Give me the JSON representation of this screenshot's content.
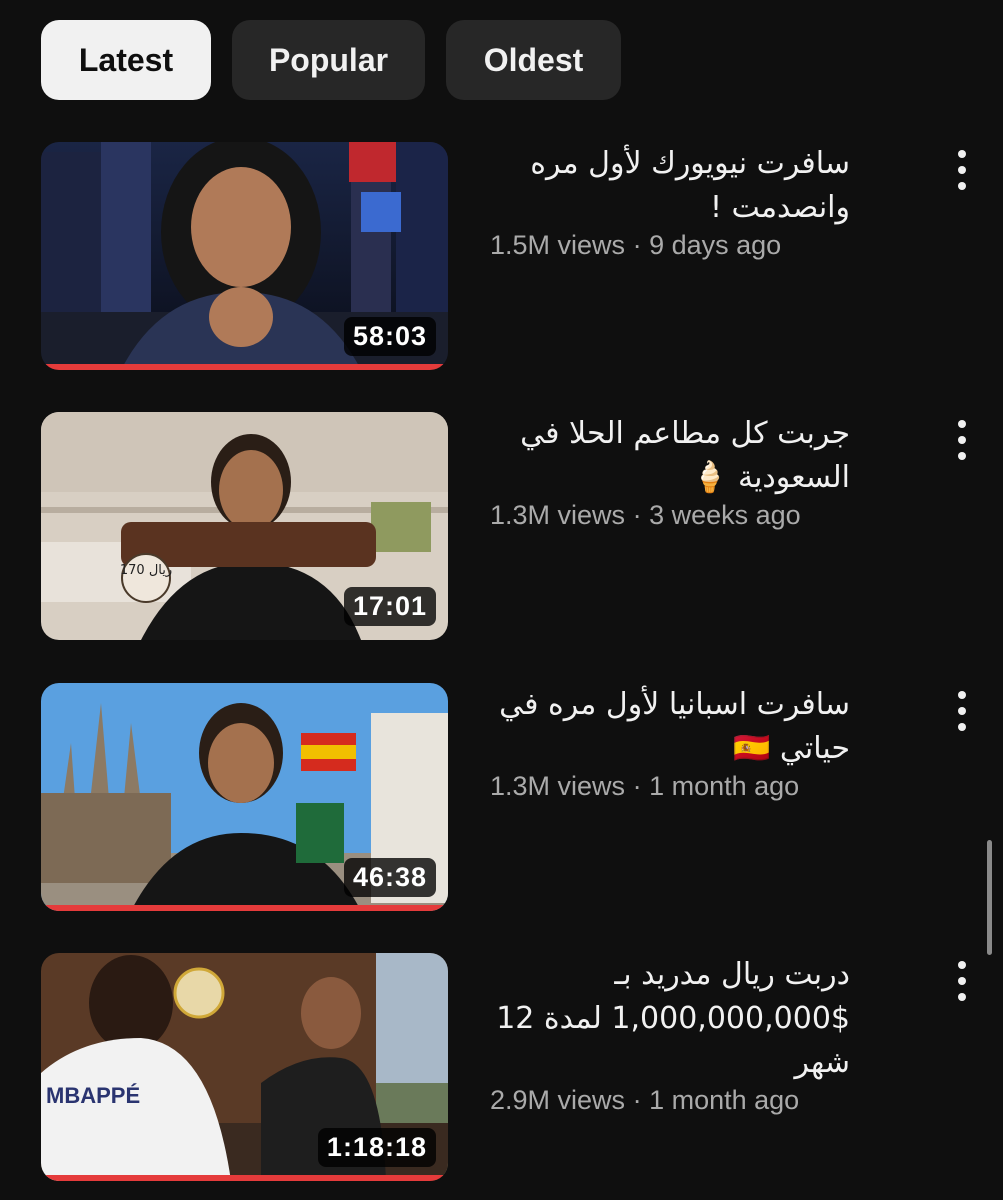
{
  "filters": [
    {
      "label": "Latest",
      "active": true
    },
    {
      "label": "Popular",
      "active": false
    },
    {
      "label": "Oldest",
      "active": false
    }
  ],
  "videos": [
    {
      "title": "سافرت نيويورك لأول مره وانصدمت !",
      "views": "1.5M views",
      "age": "9 days ago",
      "duration": "58:03",
      "progress": 1.0
    },
    {
      "title": "جربت كل مطاعم الحلا في السعودية 🍦",
      "views": "1.3M views",
      "age": "3 weeks ago",
      "duration": "17:01",
      "thumb_tag": "170 ريال",
      "progress": 0
    },
    {
      "title": "سافرت اسبانيا لأول مره في حياتي 🇪🇸",
      "views": "1.3M views",
      "age": "1 month ago",
      "duration": "46:38",
      "progress": 1.0
    },
    {
      "title": "دربت ريال مدريد بـ $1,000,000,000 لمدة 12 شهر",
      "views": "2.9M views",
      "age": "1 month ago",
      "duration": "1:18:18",
      "thumb_jersey": "MBAPPÉ",
      "progress": 1.0
    }
  ],
  "separator": "·",
  "colors": {
    "background": "#0f0f0f",
    "chip": "#272727",
    "chip_active": "#f1f1f1",
    "progress": "#e53b3b",
    "meta_text": "#aaaaaa"
  }
}
